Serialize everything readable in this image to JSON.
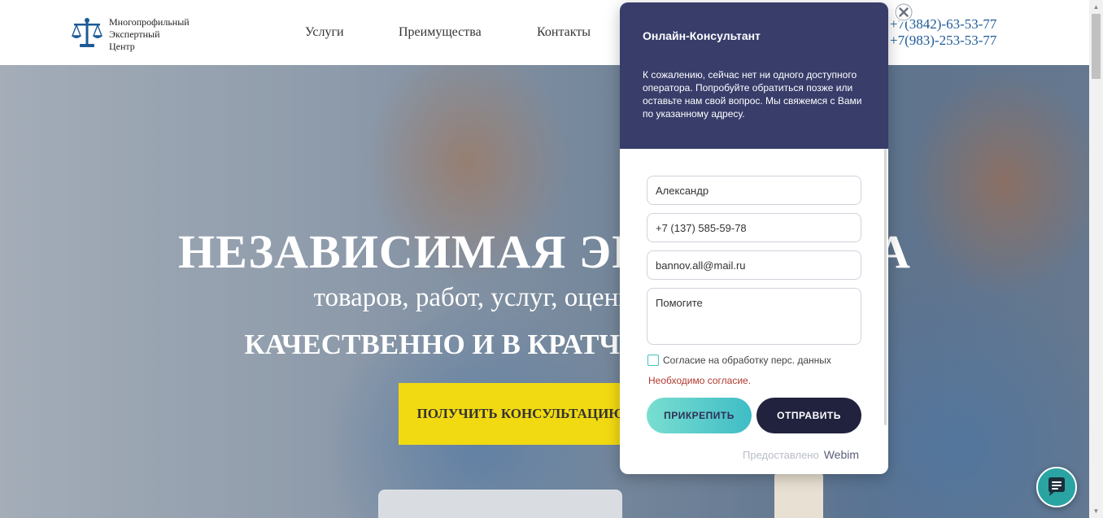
{
  "header": {
    "logo": {
      "line1": "Многопрофильный",
      "line2": "Экспертный",
      "line3": "Центр",
      "icon": "scales-icon"
    },
    "nav": [
      {
        "label": "Услуги"
      },
      {
        "label": "Преимущества"
      },
      {
        "label": "Контакты"
      }
    ],
    "phones": [
      "+7(3842)-63-53-77",
      "+7(983)-253-53-77"
    ]
  },
  "hero": {
    "title": "НЕЗАВИСИМАЯ ЭКСПЕРТИЗА",
    "subtitle": "товаров, работ, услуг, оценка имущества",
    "tagline": "КАЧЕСТВЕННО И В КРАТЧАЙШИЕ СРОКИ",
    "cta_label": "ПОЛУЧИТЬ КОНСУЛЬТАЦИЮ"
  },
  "chat": {
    "title": "Онлайн-Консультант",
    "message": "К сожалению, сейчас нет ни одного доступного оператора. Попробуйте обратиться позже или оставьте нам свой вопрос. Мы свяжемся с Вами по указанному адресу.",
    "name_value": "Александр",
    "phone_value": "+7 (137) 585-59-78",
    "email_value": "bannov.all@mail.ru",
    "question_value": "Помогите",
    "consent_label": "Согласие на обработку перс. данных",
    "consent_error": "Необходимо согласие.",
    "attach_label": "ПРИКРЕПИТЬ",
    "send_label": "ОТПРАВИТЬ",
    "powered_by": "Предоставлено",
    "brand": "Webim",
    "close_icon": "close-icon",
    "fab_icon": "chat-bubble-icon"
  },
  "colors": {
    "chat_header": "#383d6a",
    "cta": "#f2da12",
    "attach_gradient_start": "#79ded0",
    "attach_gradient_end": "#3fbcc6",
    "send": "#20223e",
    "fab": "#2aa3a3",
    "phone_text": "#1e5a96"
  }
}
